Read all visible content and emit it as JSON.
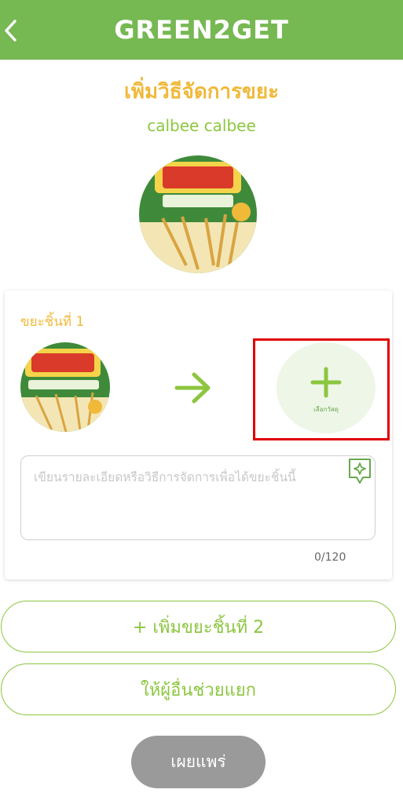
{
  "header": {
    "app_title": "GREEN2GET",
    "back_icon": "chevron-left-icon",
    "color": "#76b852"
  },
  "page_title": "เพิ่มวิธีจัดการขยะ",
  "product_name": "calbee calbee",
  "piece": {
    "label": "ขยะชิ้นที่ 1",
    "arrow_icon": "arrow-right-icon",
    "material_select_label": "เลือกวัสดุ",
    "plus_icon": "plus-icon"
  },
  "description": {
    "placeholder": "เขียนรายละเอียดหรือวิธีการจัดการเพื่อได้ขยะชิ้นนี้",
    "value": "",
    "char_count": "0/120",
    "ai_icon": "sparkle-chat-icon"
  },
  "buttons": {
    "add_piece": "+ เพิ่มขยะชิ้นที่ 2",
    "help_sort": "ให้ผู้อื่นช่วยแยก",
    "publish": "เผยแพร่"
  },
  "colors": {
    "accent": "#8cc63f",
    "title": "#f0b93a",
    "highlight": "#e00000",
    "disabled": "#9a9a9a"
  }
}
